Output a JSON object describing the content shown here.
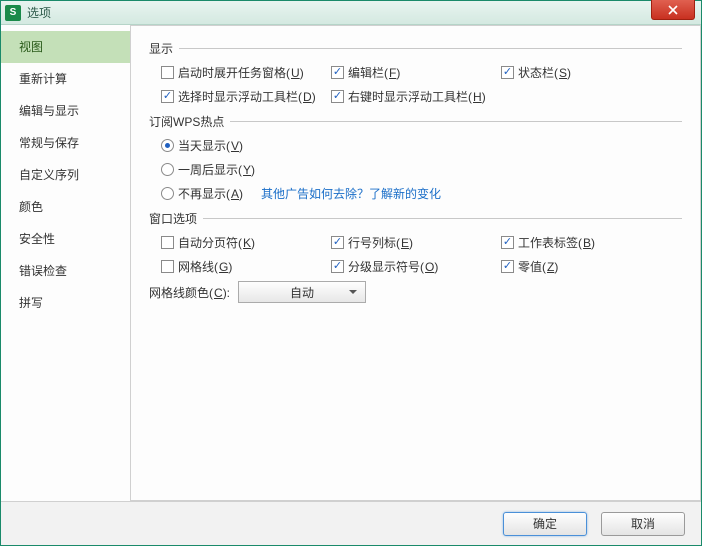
{
  "title": "选项",
  "sidebar": {
    "items": [
      {
        "label": "视图",
        "active": true
      },
      {
        "label": "重新计算"
      },
      {
        "label": "编辑与显示"
      },
      {
        "label": "常规与保存"
      },
      {
        "label": "自定义序列"
      },
      {
        "label": "颜色"
      },
      {
        "label": "安全性"
      },
      {
        "label": "错误检查"
      },
      {
        "label": "拼写"
      }
    ]
  },
  "groups": {
    "display": {
      "title": "显示",
      "opts": {
        "taskpane": {
          "label": "启动时展开任务窗格",
          "mnem": "U",
          "checked": false
        },
        "formulabar": {
          "label": "编辑栏",
          "mnem": "F",
          "checked": true
        },
        "statusbar": {
          "label": "状态栏",
          "mnem": "S",
          "checked": true
        },
        "floattool_sel": {
          "label": "选择时显示浮动工具栏",
          "mnem": "D",
          "checked": true
        },
        "floattool_rclick": {
          "label": "右键时显示浮动工具栏",
          "mnem": "H",
          "checked": true
        }
      }
    },
    "wps": {
      "title": "订阅WPS热点",
      "opts": {
        "today": {
          "label": "当天显示",
          "mnem": "V",
          "checked": true
        },
        "weeklater": {
          "label": "一周后显示",
          "mnem": "Y",
          "checked": false
        },
        "never": {
          "label": "不再显示",
          "mnem": "A",
          "checked": false
        }
      },
      "link": "其他广告如何去除？了解新的变化"
    },
    "window": {
      "title": "窗口选项",
      "opts": {
        "pagebreak": {
          "label": "自动分页符",
          "mnem": "K",
          "checked": false
        },
        "rowcol": {
          "label": "行号列标",
          "mnem": "E",
          "checked": true
        },
        "sheettabs": {
          "label": "工作表标签",
          "mnem": "B",
          "checked": true
        },
        "grid": {
          "label": "网格线",
          "mnem": "G",
          "checked": false
        },
        "outline": {
          "label": "分级显示符号",
          "mnem": "O",
          "checked": true
        },
        "zero": {
          "label": "零值",
          "mnem": "Z",
          "checked": true
        }
      },
      "gridcolor_label": "网格线颜色",
      "gridcolor_mnem": "C",
      "gridcolor_value": "自动"
    }
  },
  "buttons": {
    "ok": "确定",
    "cancel": "取消"
  },
  "title_icon_letter": "S"
}
